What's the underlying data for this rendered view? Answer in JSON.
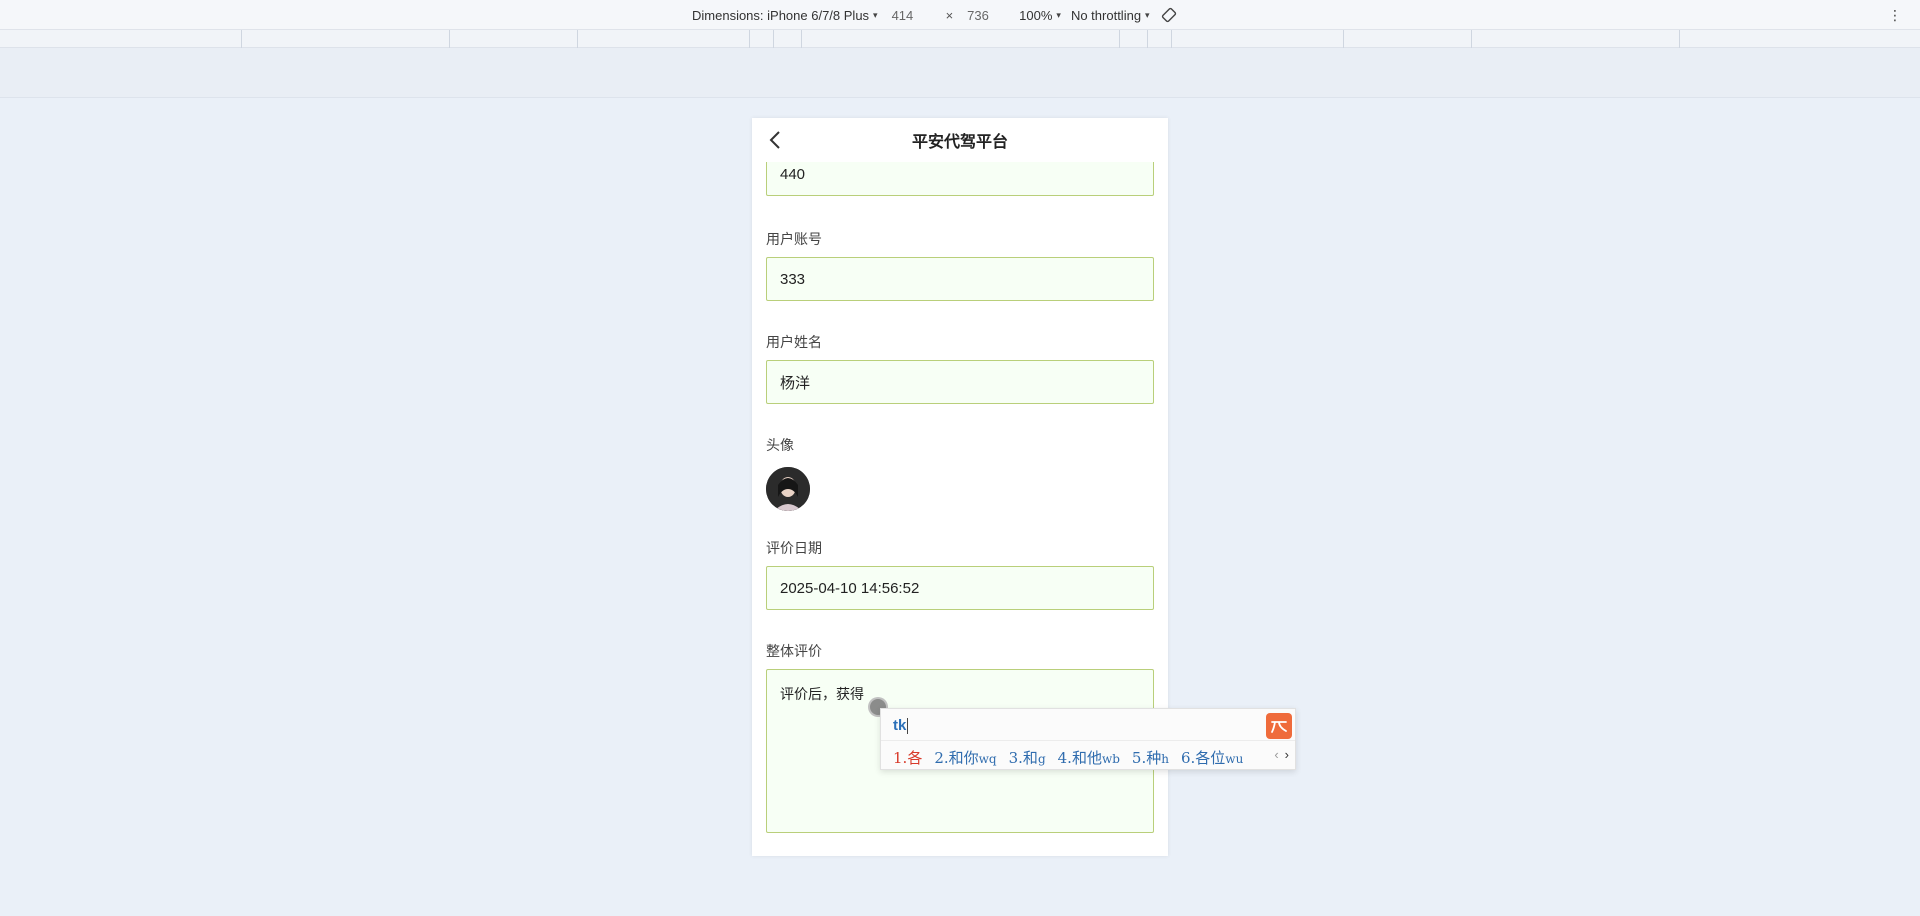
{
  "devtools": {
    "dimensions_label": "Dimensions: iPhone 6/7/8 Plus",
    "width": "414",
    "times": "×",
    "height": "736",
    "zoom": "100%",
    "throttling": "No throttling",
    "caret": "▾",
    "more": "⋮"
  },
  "app": {
    "title": "平安代驾平台",
    "fields": {
      "top_value": "440",
      "account_label": "用户账号",
      "account_value": "333",
      "name_label": "用户姓名",
      "name_value": "杨洋",
      "avatar_label": "头像",
      "date_label": "评价日期",
      "date_value": "2025-04-10 14:56:52",
      "review_label": "整体评价",
      "review_value": "评价后，获得"
    }
  },
  "ime": {
    "input": "tk",
    "candidates": [
      {
        "num": "1.",
        "text": "各",
        "hint": ""
      },
      {
        "num": "2.",
        "text": "和你",
        "hint": "wq"
      },
      {
        "num": "3.",
        "text": "和",
        "hint": "g"
      },
      {
        "num": "4.",
        "text": "和他",
        "hint": "wb"
      },
      {
        "num": "5.",
        "text": "种",
        "hint": "h"
      },
      {
        "num": "6.",
        "text": "各位",
        "hint": "wu"
      }
    ],
    "prev": "‹",
    "next": "›",
    "accent": "#ef6b3b"
  }
}
